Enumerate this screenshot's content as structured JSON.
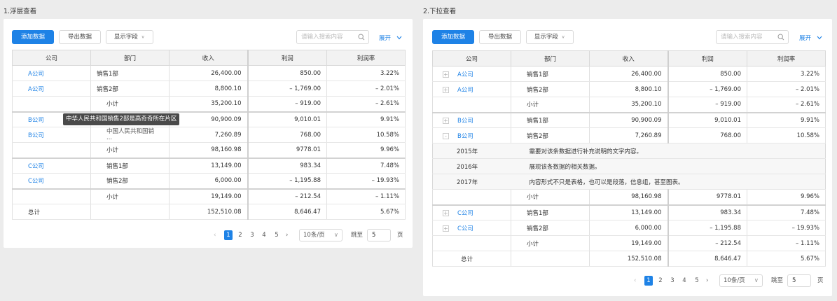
{
  "sections": [
    {
      "title": "1.浮层查看"
    },
    {
      "title": "2.下拉查看"
    }
  ],
  "toolbar": {
    "add": "添加数据",
    "export": "导出数据",
    "fields": "显示字段",
    "search_placeholder": "请输入搜索内容",
    "expand": "展开"
  },
  "columns": [
    "公司",
    "部门",
    "收入",
    "利润",
    "利润率"
  ],
  "table1": [
    {
      "company": "A公司",
      "dept": "销售1部",
      "income": "26,400.00",
      "profit": "850.00",
      "rate": "3.22%"
    },
    {
      "company": "A公司",
      "dept": "销售2部",
      "income": "8,800.10",
      "profit": "– 1,769.00",
      "rate": "– 2.01%"
    },
    {
      "company": "",
      "dept": "小计",
      "income": "35,200.10",
      "profit": "– 919.00",
      "rate": "– 2.61%"
    },
    {
      "company": "B公司",
      "dept": "",
      "income": "90,900.09",
      "profit": "9,010.01",
      "rate": "9.91%"
    },
    {
      "company": "B公司",
      "dept": "中国人民共和国销",
      "dept_more": "...",
      "income": "7,260.89",
      "profit": "768.00",
      "rate": "10.58%"
    },
    {
      "company": "",
      "dept": "小计",
      "income": "98,160.98",
      "profit": "9778.01",
      "rate": "9.96%"
    },
    {
      "company": "C公司",
      "dept": "销售1部",
      "income": "13,149.00",
      "profit": "983.34",
      "rate": "7.48%"
    },
    {
      "company": "C公司",
      "dept": "销售2部",
      "income": "6,000.00",
      "profit": "– 1,195.88",
      "rate": "– 19.93%"
    },
    {
      "company": "",
      "dept": "小计",
      "income": "19,149.00",
      "profit": "– 212.54",
      "rate": "– 1.11%"
    },
    {
      "company": "总计",
      "dept": "",
      "income": "152,510.08",
      "profit": "8,646.47",
      "rate": "5.67%"
    }
  ],
  "tooltip": "中华人民共和国销售2部是高奇奇所在片区",
  "table2": [
    {
      "company": "A公司",
      "dept": "销售1部",
      "income": "26,400.00",
      "profit": "850.00",
      "rate": "3.22%"
    },
    {
      "company": "A公司",
      "dept": "销售2部",
      "income": "8,800.10",
      "profit": "– 1,769.00",
      "rate": "– 2.01%"
    },
    {
      "company": "",
      "dept": "小计",
      "income": "35,200.10",
      "profit": "– 919.00",
      "rate": "– 2.61%"
    },
    {
      "company": "B公司",
      "dept": "销售1部",
      "income": "90,900.09",
      "profit": "9,010.01",
      "rate": "9.91%"
    },
    {
      "company": "B公司",
      "dept": "销售2部",
      "income": "7,260.89",
      "profit": "768.00",
      "rate": "10.58%"
    },
    {
      "company": "",
      "dept": "小计",
      "income": "98,160.98",
      "profit": "9778.01",
      "rate": "9.96%"
    },
    {
      "company": "C公司",
      "dept": "销售1部",
      "income": "13,149.00",
      "profit": "983.34",
      "rate": "7.48%"
    },
    {
      "company": "C公司",
      "dept": "销售2部",
      "income": "6,000.00",
      "profit": "– 1,195.88",
      "rate": "– 19.93%"
    },
    {
      "company": "",
      "dept": "小计",
      "income": "19,149.00",
      "profit": "– 212.54",
      "rate": "– 1.11%"
    },
    {
      "company": "总计",
      "dept": "",
      "income": "152,510.08",
      "profit": "8,646.47",
      "rate": "5.67%"
    }
  ],
  "details": [
    {
      "year": "2015年",
      "text": "需要对该条数据进行补充说明的文字内容。"
    },
    {
      "year": "2016年",
      "text": "展现该条数据的相关数据。"
    },
    {
      "year": "2017年",
      "text": "内容形式不只是表格，也可以是段落，信息组，甚至图表。"
    }
  ],
  "pager": {
    "pages": [
      "1",
      "2",
      "3",
      "4",
      "5"
    ],
    "page_size": "10条/页",
    "jump_label": "跳至",
    "jump_value": "5",
    "page_unit": "页"
  },
  "colors": {
    "accent": "#1e82e6"
  }
}
